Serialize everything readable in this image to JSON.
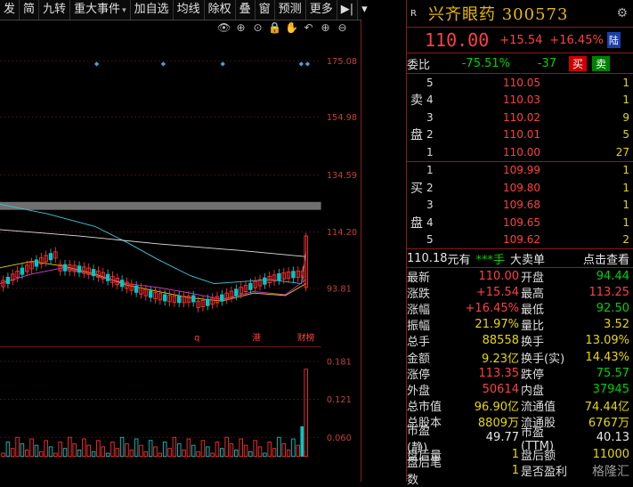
{
  "toolbar": {
    "items": [
      "发",
      "简",
      "九转",
      "重大事件",
      "加自选",
      "均线",
      "除权",
      "叠",
      "窗",
      "预测",
      "更多"
    ],
    "arrow": "▾",
    "nav_icon": "▶|"
  },
  "chart": {
    "price_ticks": [
      "175.08",
      "154.98",
      "134.59",
      "114.20",
      "93.81"
    ],
    "volume_ticks": [
      "0.181",
      "0.121",
      "0.060"
    ],
    "markers": [
      "q",
      "港",
      "财榜"
    ],
    "icons": [
      "👁",
      "⊕",
      "⊙",
      "🔒",
      "✋",
      "↶",
      "⊕",
      "⊖"
    ],
    "colors": {
      "up": "#ff3030",
      "down": "#00c8c8",
      "ma_white": "#e0e0e0",
      "ma_yellow": "#e8d800",
      "ma_purple": "#d040d0",
      "ma_cyan": "#40c8d8",
      "band": "#707070",
      "axis": "#8b1a1a"
    }
  },
  "quote": {
    "badge": "R",
    "name": "兴齐眼药 300573",
    "price": "110.00",
    "change": "+15.54",
    "pct": "+16.45%",
    "market": "陆",
    "weibi_label": "委比",
    "weibi": "-75.51%",
    "weicha": "-37",
    "buy_btn": "买",
    "sell_btn": "卖"
  },
  "ask_label": [
    "卖",
    "盘"
  ],
  "bid_label": [
    "买",
    "盘"
  ],
  "asks": [
    {
      "lvl": "5",
      "price": "110.05",
      "vol": "1"
    },
    {
      "lvl": "4",
      "price": "110.03",
      "vol": "1"
    },
    {
      "lvl": "3",
      "price": "110.02",
      "vol": "9"
    },
    {
      "lvl": "2",
      "price": "110.01",
      "vol": "5"
    },
    {
      "lvl": "1",
      "price": "110.00",
      "vol": "27"
    }
  ],
  "bids": [
    {
      "lvl": "1",
      "price": "109.99",
      "vol": "1"
    },
    {
      "lvl": "2",
      "price": "109.80",
      "vol": "1"
    },
    {
      "lvl": "3",
      "price": "109.68",
      "vol": "1"
    },
    {
      "lvl": "4",
      "price": "109.65",
      "vol": "1"
    },
    {
      "lvl": "5",
      "price": "109.62",
      "vol": "2"
    }
  ],
  "summary": {
    "price": "110.18",
    "unit": "元有",
    "stars": "***手",
    "big_sell": "大卖单",
    "click": "点击查看"
  },
  "stats": [
    {
      "l": "最新",
      "v": "110.00",
      "vc": "red",
      "l2": "开盘",
      "v2": "94.44",
      "v2c": "green"
    },
    {
      "l": "涨跌",
      "v": "+15.54",
      "vc": "red",
      "l2": "最高",
      "v2": "113.25",
      "v2c": "red"
    },
    {
      "l": "涨幅",
      "v": "+16.45%",
      "vc": "red",
      "l2": "最低",
      "v2": "92.50",
      "v2c": "green"
    },
    {
      "l": "振幅",
      "v": "21.97%",
      "vc": "yellow",
      "l2": "量比",
      "v2": "3.52",
      "v2c": "yellow"
    },
    {
      "l": "总手",
      "v": "88558",
      "vc": "yellow",
      "l2": "换手",
      "v2": "13.09%",
      "v2c": "yellow"
    },
    {
      "l": "金额",
      "v": "9.23亿",
      "vc": "yellow",
      "l2": "换手(实)",
      "v2": "14.43%",
      "v2c": "yellow"
    },
    {
      "l": "涨停",
      "v": "113.35",
      "vc": "red",
      "l2": "跌停",
      "v2": "75.57",
      "v2c": "green"
    },
    {
      "l": "外盘",
      "v": "50614",
      "vc": "red",
      "l2": "内盘",
      "v2": "37945",
      "v2c": "green"
    },
    {
      "l": "总市值",
      "v": "96.90亿",
      "vc": "yellow",
      "l2": "流通值",
      "v2": "74.44亿",
      "v2c": "yellow"
    },
    {
      "l": "总股本",
      "v": "8809万",
      "vc": "yellow",
      "l2": "流通股",
      "v2": "6767万",
      "v2c": "yellow"
    },
    {
      "l": "市盈(静)",
      "v": "49.77",
      "vc": "white",
      "l2": "市盈(TTM)",
      "v2": "40.13",
      "v2c": "white"
    },
    {
      "l": "盘后量",
      "v": "1",
      "vc": "yellow",
      "l2": "盘后额",
      "v2": "11000",
      "v2c": "yellow"
    },
    {
      "l": "盘后笔数",
      "v": "1",
      "vc": "yellow",
      "l2": "是否盈利",
      "v2": "",
      "v2c": "white"
    }
  ],
  "watermark": "格隆汇"
}
